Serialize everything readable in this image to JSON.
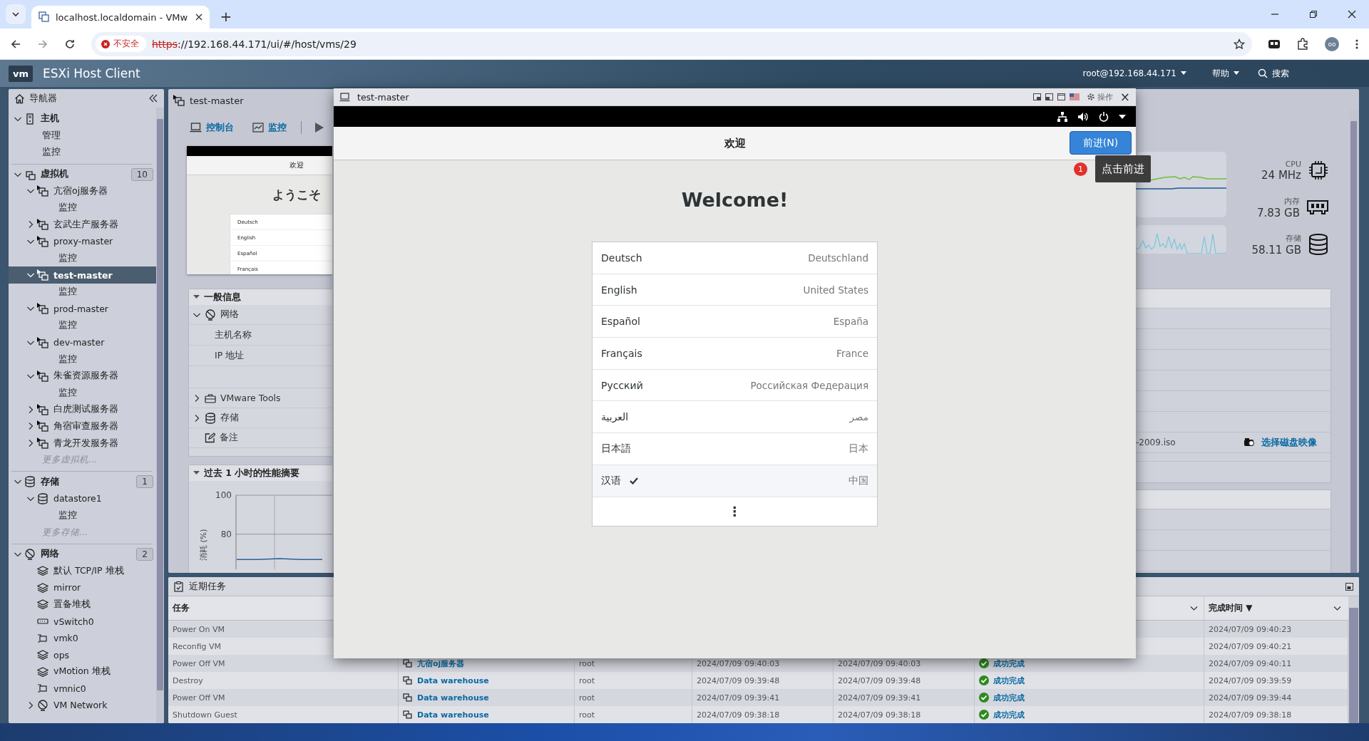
{
  "browser": {
    "tab_title": "localhost.localdomain - VMw",
    "new_tab": "+",
    "security": "不安全",
    "url_scheme": "https",
    "url_rest": "://192.168.44.171/ui/#/host/vms/29",
    "profile": "oo"
  },
  "app_header": {
    "logo": "vm",
    "title": "ESXi Host Client",
    "user": "root@192.168.44.171",
    "help": "帮助",
    "search": "搜索"
  },
  "navigator": {
    "title": "导航器",
    "sections": [
      {
        "label": "主机",
        "kind": "host",
        "expanded": true,
        "children": [
          {
            "label": "管理",
            "kind": "link"
          },
          {
            "label": "监控",
            "kind": "link"
          }
        ]
      },
      {
        "label": "虚拟机",
        "kind": "vms",
        "expanded": true,
        "badge": "10",
        "children": [
          {
            "label": "亢宿oj服务器",
            "kind": "vm",
            "powered_on": true,
            "expanded": true,
            "selected": false,
            "children": [
              {
                "label": "监控",
                "kind": "link"
              }
            ]
          },
          {
            "label": "玄武生产服务器",
            "kind": "vm",
            "powered_on": true,
            "expanded": false,
            "selected": false
          },
          {
            "label": "proxy-master",
            "kind": "vm",
            "powered_on": true,
            "expanded": true,
            "selected": false,
            "children": [
              {
                "label": "监控",
                "kind": "link"
              }
            ]
          },
          {
            "label": "test-master",
            "kind": "vm",
            "powered_on": true,
            "expanded": true,
            "selected": true,
            "children": [
              {
                "label": "监控",
                "kind": "link"
              }
            ]
          },
          {
            "label": "prod-master",
            "kind": "vm",
            "powered_on": true,
            "expanded": true,
            "selected": false,
            "children": [
              {
                "label": "监控",
                "kind": "link"
              }
            ]
          },
          {
            "label": "dev-master",
            "kind": "vm",
            "powered_on": true,
            "expanded": true,
            "selected": false,
            "children": [
              {
                "label": "监控",
                "kind": "link"
              }
            ]
          },
          {
            "label": "朱雀资源服务器",
            "kind": "vm",
            "powered_on": true,
            "expanded": true,
            "selected": false,
            "children": [
              {
                "label": "监控",
                "kind": "link"
              }
            ]
          },
          {
            "label": "白虎测试服务器",
            "kind": "vm",
            "powered_on": true,
            "expanded": false,
            "selected": false
          },
          {
            "label": "角宿审查服务器",
            "kind": "vm",
            "powered_on": true,
            "expanded": false,
            "selected": false
          },
          {
            "label": "青龙开发服务器",
            "kind": "vm",
            "powered_on": true,
            "expanded": false,
            "selected": false
          },
          {
            "label": "更多虚拟机...",
            "kind": "more"
          }
        ]
      },
      {
        "label": "存储",
        "kind": "storage",
        "expanded": true,
        "badge": "1",
        "children": [
          {
            "label": "datastore1",
            "kind": "datastore",
            "expanded": true,
            "selected": false,
            "children": [
              {
                "label": "监控",
                "kind": "link"
              }
            ]
          },
          {
            "label": "更多存储...",
            "kind": "more"
          }
        ]
      },
      {
        "label": "网络",
        "kind": "network",
        "expanded": true,
        "badge": "2",
        "children": [
          {
            "label": "默认 TCP/IP 堆栈",
            "kind": "stack",
            "selected": false
          },
          {
            "label": "mirror",
            "kind": "stack",
            "selected": false
          },
          {
            "label": "置备堆栈",
            "kind": "stack",
            "selected": false
          },
          {
            "label": "vSwitch0",
            "kind": "switch",
            "selected": false
          },
          {
            "label": "vmk0",
            "kind": "adapter",
            "selected": false
          },
          {
            "label": "ops",
            "kind": "stack",
            "selected": false
          },
          {
            "label": "vMotion 堆栈",
            "kind": "stack",
            "selected": false
          },
          {
            "label": "vmnic0",
            "kind": "adapter",
            "selected": false
          },
          {
            "label": "VM Network",
            "kind": "network",
            "expanded": false,
            "selected": false
          }
        ]
      }
    ]
  },
  "vm_panel": {
    "title": "test-master",
    "powered_on": true,
    "actions": [
      {
        "label": "控制台",
        "kind": "console"
      },
      {
        "label": "监控",
        "kind": "monitor"
      },
      {
        "kind": "power_on"
      }
    ],
    "thumbnail": {
      "header": "欢迎",
      "greeting": "ようこそ",
      "languages": [
        "Deutsch",
        "English",
        "Español",
        "Français"
      ]
    },
    "general": {
      "title": "一般信息",
      "expanded": true,
      "items": [
        {
          "label": "网络",
          "kind": "network",
          "expanded": true,
          "fields": [
            "主机名称",
            "IP 地址"
          ]
        },
        {
          "label": "VMware Tools",
          "kind": "tools",
          "expanded": false
        },
        {
          "label": "存储",
          "kind": "storage",
          "expanded": false
        },
        {
          "label": "备注",
          "kind": "notes"
        }
      ]
    },
    "performance": {
      "title": "过去 1 小时的性能摘要",
      "expanded": true,
      "chart_data": {
        "type": "line",
        "ylabel": "消耗 (%)",
        "ylim": [
          62,
          100
        ],
        "yticks": [
          80,
          100
        ],
        "series": [
          {
            "color": "#2a5f9e",
            "values": [
              67,
              67,
              67.5,
              67,
              67
            ]
          }
        ]
      }
    }
  },
  "summary": {
    "stats": [
      {
        "label": "CPU",
        "value": "24 MHz",
        "kind": "cpu"
      },
      {
        "label": "内存",
        "value": "7.83 GB",
        "kind": "memory"
      },
      {
        "label": "存储",
        "value": "58.11 GB",
        "kind": "storage"
      }
    ],
    "hardware": {
      "iso": "-2009.iso",
      "action": "选择磁盘映像"
    }
  },
  "tasks": {
    "title": "近期任务",
    "first_column": "任务",
    "last_column": "完成时间",
    "sort": "▼",
    "rows": [
      {
        "task": "Power On VM",
        "completed": "2024/07/09 09:40:23"
      },
      {
        "task": "Reconfig VM",
        "completed": "2024/07/09 09:40:21"
      },
      {
        "task": "Power Off VM",
        "target": "亢宿oj服务器",
        "initiator": "root",
        "queued": "2024/07/09 09:40:03",
        "started": "2024/07/09 09:40:03",
        "result": "成功完成",
        "completed": "2024/07/09 09:40:11"
      },
      {
        "task": "Destroy",
        "target": "Data warehouse",
        "initiator": "root",
        "queued": "2024/07/09 09:39:48",
        "started": "2024/07/09 09:39:48",
        "result": "成功完成",
        "completed": "2024/07/09 09:39:59"
      },
      {
        "task": "Power Off VM",
        "target": "Data warehouse",
        "initiator": "root",
        "queued": "2024/07/09 09:39:41",
        "started": "2024/07/09 09:39:41",
        "result": "成功完成",
        "completed": "2024/07/09 09:39:44"
      },
      {
        "task": "Shutdown Guest",
        "target": "Data warehouse",
        "initiator": "root",
        "queued": "2024/07/09 09:38:18",
        "started": "2024/07/09 09:38:18",
        "result": "成功完成",
        "completed": "2024/07/09 09:38:18"
      }
    ]
  },
  "console": {
    "title": "test-master",
    "actions_label": "操作",
    "close": "×",
    "header": "欢迎",
    "next_button": "前进(N)",
    "hint": {
      "badge": "1",
      "text": "点击前进"
    },
    "heading": "Welcome!",
    "languages": [
      {
        "name": "Deutsch",
        "region": "Deutschland",
        "selected": false
      },
      {
        "name": "English",
        "region": "United States",
        "selected": false
      },
      {
        "name": "Español",
        "region": "España",
        "selected": false
      },
      {
        "name": "Français",
        "region": "France",
        "selected": false
      },
      {
        "name": "Русский",
        "region": "Российская Федерация",
        "selected": false
      },
      {
        "name": "العربية",
        "region": "مصر",
        "selected": false
      },
      {
        "name": "日本語",
        "region": "日本",
        "selected": false
      },
      {
        "name": "汉语",
        "region": "中国",
        "selected": true
      }
    ],
    "more": "⋮"
  }
}
